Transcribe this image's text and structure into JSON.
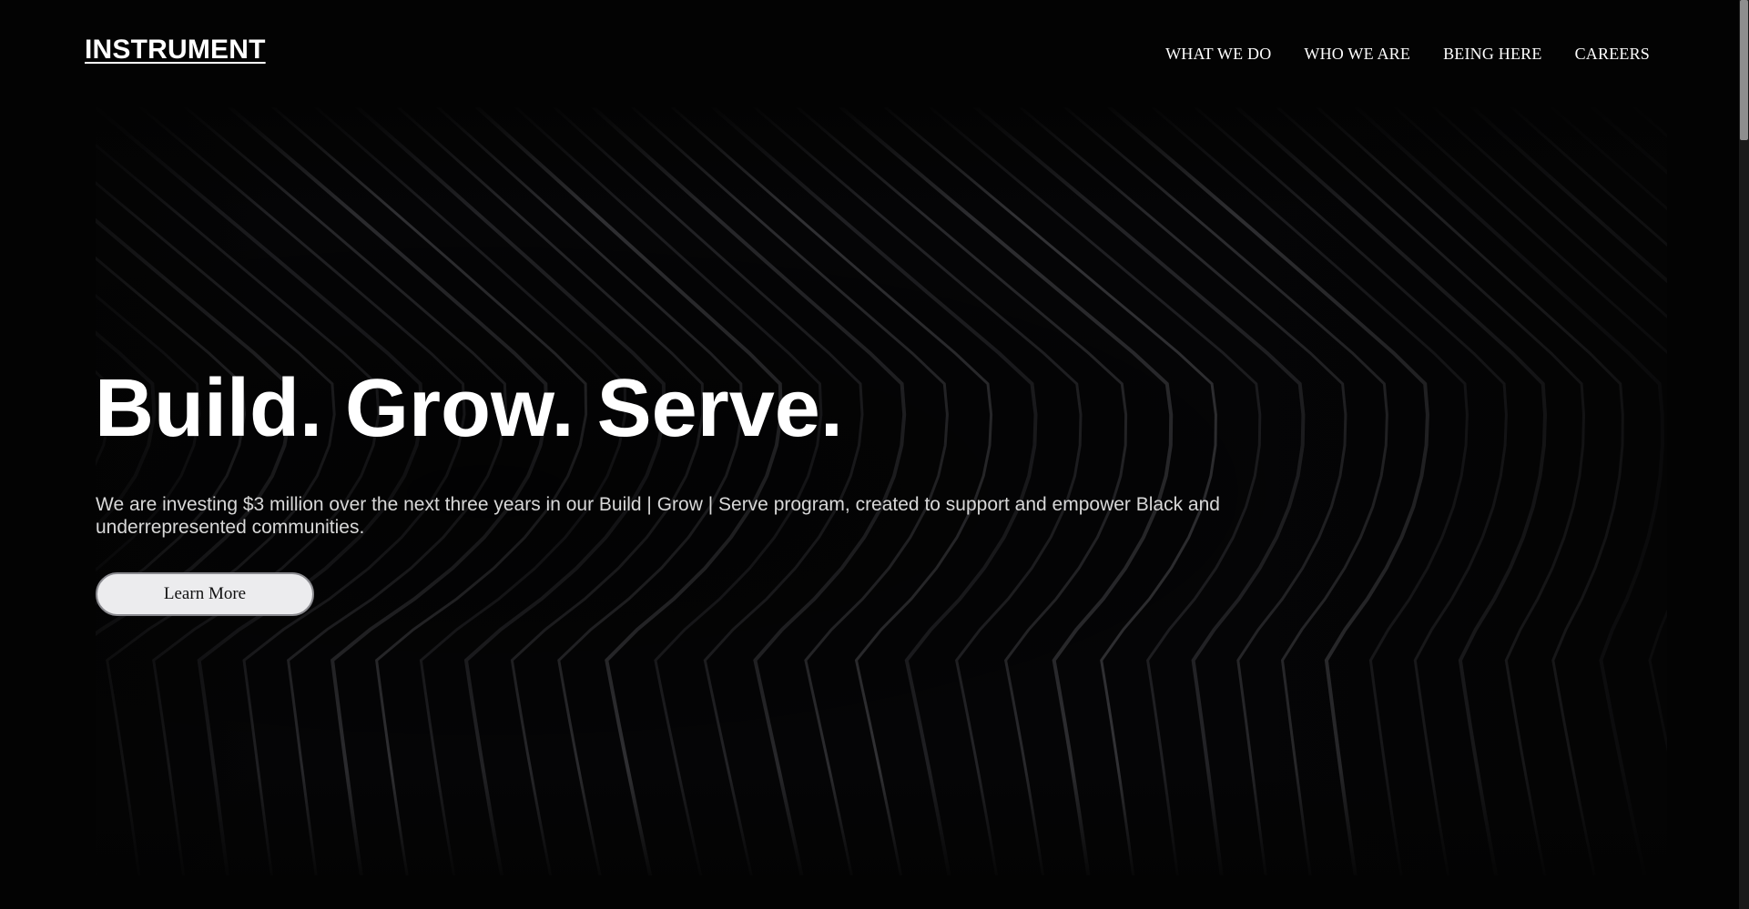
{
  "header": {
    "logo": "INSTRUMENT",
    "nav": [
      {
        "label": "WHAT WE DO"
      },
      {
        "label": "WHO WE ARE"
      },
      {
        "label": "BEING HERE"
      },
      {
        "label": "CAREERS"
      }
    ]
  },
  "hero": {
    "title": "Build. Grow. Serve.",
    "description": "We are investing $3 million over the next three years in our Build | Grow | Serve program, created to support and empower Black and underrepresented communities.",
    "cta_label": "Learn More",
    "background_icon": "abstract-lines-pattern"
  },
  "colors": {
    "background": "#030303",
    "text": "#ffffff",
    "body_text": "#d8d8d8",
    "button_bg": "#ececee",
    "button_text": "#111111"
  }
}
